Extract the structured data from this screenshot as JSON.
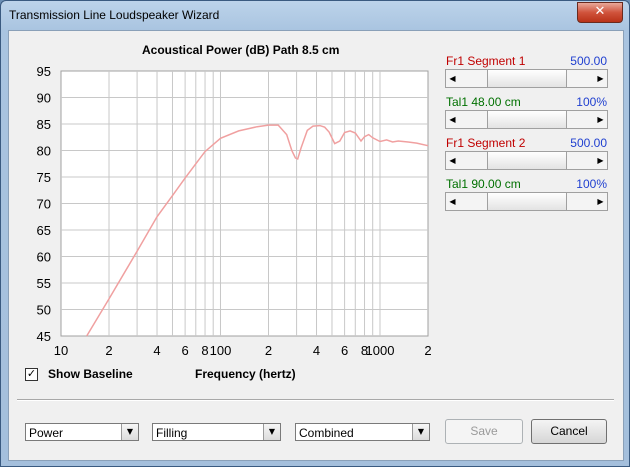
{
  "window": {
    "title": "Transmission Line Loudspeaker Wizard",
    "close_glyph": "✕"
  },
  "chart_data": {
    "type": "line",
    "title": "Acoustical Power (dB)   Path 8.5 cm",
    "xlabel": "Frequency (hertz)",
    "ylabel": "",
    "x_scale": "log",
    "xlim": [
      10,
      2000
    ],
    "ylim": [
      45,
      95
    ],
    "grid": true,
    "y_ticks": [
      "95",
      "90",
      "85",
      "80",
      "75",
      "70",
      "65",
      "60",
      "55",
      "50",
      "45"
    ],
    "x_ticks": [
      "10",
      "2",
      "4",
      "6",
      "8",
      "100",
      "2",
      "4",
      "6",
      "8",
      "1000",
      "2"
    ],
    "series": [
      {
        "color": "#f0a0a0",
        "x": [
          14.5,
          20,
          30,
          40,
          50,
          60,
          70,
          80,
          100,
          130,
          170,
          200,
          230,
          260,
          280,
          295,
          305,
          320,
          350,
          380,
          420,
          450,
          480,
          520,
          560,
          600,
          650,
          700,
          760,
          800,
          850,
          900,
          1000,
          1100,
          1200,
          1300,
          1500,
          1700,
          2000
        ],
        "y": [
          45,
          52,
          61,
          67.5,
          71.5,
          74.8,
          77.5,
          79.8,
          82.3,
          83.7,
          84.5,
          84.8,
          84.8,
          83,
          80,
          78.6,
          78.4,
          80.5,
          83.8,
          84.6,
          84.7,
          84.4,
          83.5,
          81.3,
          81.8,
          83.4,
          83.7,
          83.3,
          81.8,
          82.6,
          83,
          82.4,
          81.7,
          82,
          81.6,
          81.8,
          81.6,
          81.4,
          80.9
        ]
      }
    ]
  },
  "controls": {
    "show_baseline_label": "Show Baseline",
    "show_baseline_checked": "✓"
  },
  "side": {
    "seg1": {
      "label": "Fr1  Segment 1",
      "value": "500.00",
      "position": 0.5
    },
    "tal1a": {
      "label": "Tal1  48.00 cm",
      "value": "100%",
      "position": 0.5
    },
    "seg2": {
      "label": "Fr1  Segment 2",
      "value": "500.00",
      "position": 0.5
    },
    "tal1b": {
      "label": "Tal1  90.00 cm",
      "value": "100%",
      "position": 0.5
    }
  },
  "bottom": {
    "combo1": "Power",
    "combo2": "Filling",
    "combo3": "Combined",
    "save": "Save",
    "cancel": "Cancel"
  },
  "icons": {
    "left_arrow": "◀",
    "right_arrow": "▶",
    "dropdown": "▼"
  }
}
